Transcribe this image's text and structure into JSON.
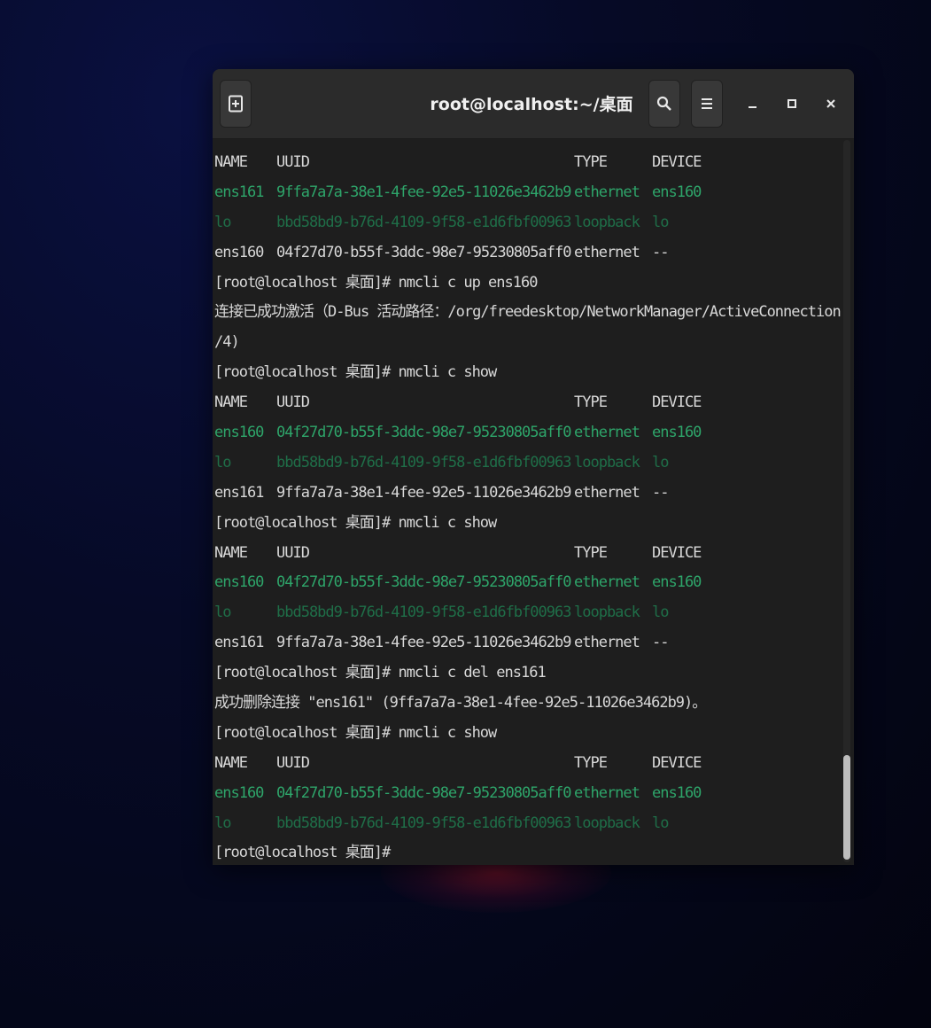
{
  "window": {
    "title": "root@localhost:~/桌面",
    "buttons": {
      "new_tab_icon": "new-tab-icon",
      "search_icon": "search-icon",
      "menu_icon": "hamburger-menu-icon",
      "minimize_icon": "minimize-icon",
      "maximize_icon": "maximize-icon",
      "close_icon": "close-icon"
    }
  },
  "colors": {
    "active_connection": "#2ea56a",
    "loopback_connection": "#1f6e48",
    "text": "#d8d8d8",
    "terminal_bg": "#1e1e1e",
    "titlebar_bg": "#2b2b2b"
  },
  "terminal": {
    "lines": [
      {
        "kind": "row",
        "style": "plain",
        "cells": [
          "NAME",
          "UUID",
          "TYPE",
          "DEVICE"
        ]
      },
      {
        "kind": "row",
        "style": "green",
        "cells": [
          "ens161",
          "9ffa7a7a-38e1-4fee-92e5-11026e3462b9",
          "ethernet",
          "ens160"
        ]
      },
      {
        "kind": "row",
        "style": "dim",
        "cells": [
          "lo",
          "bbd58bd9-b76d-4109-9f58-e1d6fbf00963",
          "loopback",
          "lo"
        ]
      },
      {
        "kind": "row",
        "style": "plain",
        "cells": [
          "ens160",
          "04f27d70-b55f-3ddc-98e7-95230805aff0",
          "ethernet",
          "--"
        ]
      },
      {
        "kind": "text",
        "style": "plain",
        "text": "[root@localhost 桌面]# nmcli c up ens160"
      },
      {
        "kind": "text",
        "style": "plain",
        "text": "连接已成功激活（D-Bus 活动路径：/org/freedesktop/NetworkManager/ActiveConnection"
      },
      {
        "kind": "text",
        "style": "plain",
        "text": "/4)"
      },
      {
        "kind": "text",
        "style": "plain",
        "text": "[root@localhost 桌面]# nmcli c show"
      },
      {
        "kind": "row",
        "style": "plain",
        "cells": [
          "NAME",
          "UUID",
          "TYPE",
          "DEVICE"
        ]
      },
      {
        "kind": "row",
        "style": "green",
        "cells": [
          "ens160",
          "04f27d70-b55f-3ddc-98e7-95230805aff0",
          "ethernet",
          "ens160"
        ]
      },
      {
        "kind": "row",
        "style": "dim",
        "cells": [
          "lo",
          "bbd58bd9-b76d-4109-9f58-e1d6fbf00963",
          "loopback",
          "lo"
        ]
      },
      {
        "kind": "row",
        "style": "plain",
        "cells": [
          "ens161",
          "9ffa7a7a-38e1-4fee-92e5-11026e3462b9",
          "ethernet",
          "--"
        ]
      },
      {
        "kind": "text",
        "style": "plain",
        "text": "[root@localhost 桌面]# nmcli c show"
      },
      {
        "kind": "row",
        "style": "plain",
        "cells": [
          "NAME",
          "UUID",
          "TYPE",
          "DEVICE"
        ]
      },
      {
        "kind": "row",
        "style": "green",
        "cells": [
          "ens160",
          "04f27d70-b55f-3ddc-98e7-95230805aff0",
          "ethernet",
          "ens160"
        ]
      },
      {
        "kind": "row",
        "style": "dim",
        "cells": [
          "lo",
          "bbd58bd9-b76d-4109-9f58-e1d6fbf00963",
          "loopback",
          "lo"
        ]
      },
      {
        "kind": "row",
        "style": "plain",
        "cells": [
          "ens161",
          "9ffa7a7a-38e1-4fee-92e5-11026e3462b9",
          "ethernet",
          "--"
        ]
      },
      {
        "kind": "text",
        "style": "plain",
        "text": "[root@localhost 桌面]# nmcli c del ens161"
      },
      {
        "kind": "text",
        "style": "plain",
        "text": "成功删除连接 \"ens161\" (9ffa7a7a-38e1-4fee-92e5-11026e3462b9)。"
      },
      {
        "kind": "text",
        "style": "plain",
        "text": "[root@localhost 桌面]# nmcli c show"
      },
      {
        "kind": "row",
        "style": "plain",
        "cells": [
          "NAME",
          "UUID",
          "TYPE",
          "DEVICE"
        ]
      },
      {
        "kind": "row",
        "style": "green",
        "cells": [
          "ens160",
          "04f27d70-b55f-3ddc-98e7-95230805aff0",
          "ethernet",
          "ens160"
        ]
      },
      {
        "kind": "row",
        "style": "dim",
        "cells": [
          "lo",
          "bbd58bd9-b76d-4109-9f58-e1d6fbf00963",
          "loopback",
          "lo"
        ]
      },
      {
        "kind": "text",
        "style": "plain",
        "text": "[root@localhost 桌面]# "
      }
    ]
  }
}
